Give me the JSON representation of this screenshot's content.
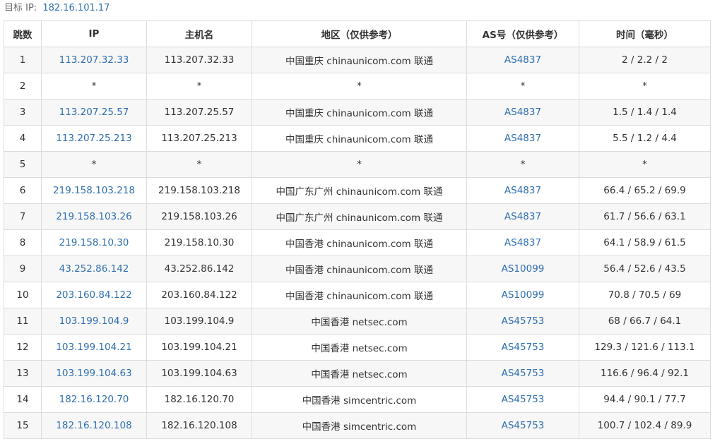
{
  "target": {
    "label": "目标 IP:",
    "ip": "182.16.101.17"
  },
  "columns": [
    "跳数",
    "IP",
    "主机名",
    "地区（仅供参考）",
    "AS号（仅供参考）",
    "时间（毫秒）"
  ],
  "rows": [
    {
      "hop": "1",
      "ip": "113.207.32.33",
      "host": "113.207.32.33",
      "region": "中国重庆 chinaunicom.com 联通",
      "as": "AS4837",
      "time": "2 / 2.2 / 2"
    },
    {
      "hop": "2",
      "ip": "*",
      "host": "*",
      "region": "*",
      "as": "*",
      "time": "*"
    },
    {
      "hop": "3",
      "ip": "113.207.25.57",
      "host": "113.207.25.57",
      "region": "中国重庆 chinaunicom.com 联通",
      "as": "AS4837",
      "time": "1.5 / 1.4 / 1.4"
    },
    {
      "hop": "4",
      "ip": "113.207.25.213",
      "host": "113.207.25.213",
      "region": "中国重庆 chinaunicom.com 联通",
      "as": "AS4837",
      "time": "5.5 / 1.2 / 4.4"
    },
    {
      "hop": "5",
      "ip": "*",
      "host": "*",
      "region": "*",
      "as": "*",
      "time": "*"
    },
    {
      "hop": "6",
      "ip": "219.158.103.218",
      "host": "219.158.103.218",
      "region": "中国广东广州 chinaunicom.com 联通",
      "as": "AS4837",
      "time": "66.4 / 65.2 / 69.9"
    },
    {
      "hop": "7",
      "ip": "219.158.103.26",
      "host": "219.158.103.26",
      "region": "中国广东广州 chinaunicom.com 联通",
      "as": "AS4837",
      "time": "61.7 / 56.6 / 63.1"
    },
    {
      "hop": "8",
      "ip": "219.158.10.30",
      "host": "219.158.10.30",
      "region": "中国香港 chinaunicom.com 联通",
      "as": "AS4837",
      "time": "64.1 / 58.9 / 61.5"
    },
    {
      "hop": "9",
      "ip": "43.252.86.142",
      "host": "43.252.86.142",
      "region": "中国香港 chinaunicom.com 联通",
      "as": "AS10099",
      "time": "56.4 / 52.6 / 43.5"
    },
    {
      "hop": "10",
      "ip": "203.160.84.122",
      "host": "203.160.84.122",
      "region": "中国香港 chinaunicom.com 联通",
      "as": "AS10099",
      "time": "70.8 / 70.5 / 69"
    },
    {
      "hop": "11",
      "ip": "103.199.104.9",
      "host": "103.199.104.9",
      "region": "中国香港 netsec.com",
      "as": "AS45753",
      "time": "68 / 66.7 / 64.1"
    },
    {
      "hop": "12",
      "ip": "103.199.104.21",
      "host": "103.199.104.21",
      "region": "中国香港 netsec.com",
      "as": "AS45753",
      "time": "129.3 / 121.6 / 113.1"
    },
    {
      "hop": "13",
      "ip": "103.199.104.63",
      "host": "103.199.104.63",
      "region": "中国香港 netsec.com",
      "as": "AS45753",
      "time": "116.6 / 96.4 / 92.1"
    },
    {
      "hop": "14",
      "ip": "182.16.120.70",
      "host": "182.16.120.70",
      "region": "中国香港 simcentric.com",
      "as": "AS45753",
      "time": "94.4 / 90.1 / 77.7"
    },
    {
      "hop": "15",
      "ip": "182.16.120.108",
      "host": "182.16.120.108",
      "region": "中国香港 simcentric.com",
      "as": "AS45753",
      "time": "100.7 / 102.4 / 89.9"
    }
  ]
}
